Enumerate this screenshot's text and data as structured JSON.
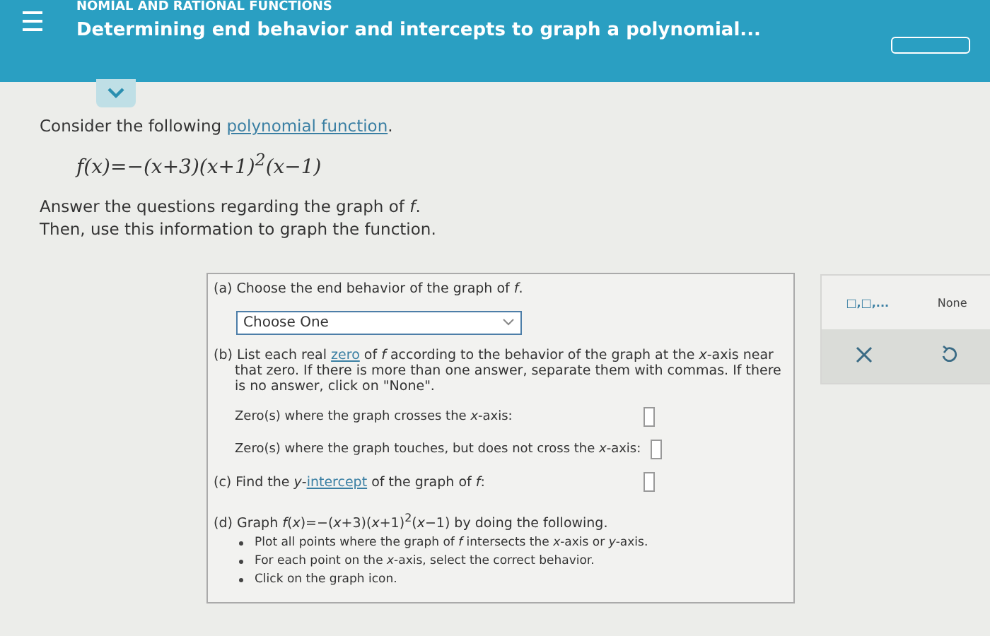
{
  "header": {
    "topic": "NOMIAL AND RATIONAL FUNCTIONS",
    "title": "Determining end behavior and intercepts to graph a polynomial..."
  },
  "intro": {
    "before": "Consider the following ",
    "link": "polynomial function",
    "after": "."
  },
  "formula": "f(x)=−(x+3)(x+1)$^{2}$(x−1)",
  "instructions": [
    "Answer the questions regarding the graph of *f*.",
    "Then, use this information to graph the function."
  ],
  "part_a": {
    "label": "(a) Choose the end behavior of the graph of *f*.",
    "dropdown": "Choose One"
  },
  "part_b": {
    "before": "(b) List each real ",
    "link": "zero",
    "after": " of *f* according to the behavior of the graph at the *x*-axis near that zero. If there is more than one answer, separate them with commas. If there is no answer, click on \"None\".",
    "fields": [
      {
        "label": "Zero(s) where the graph crosses the *x*-axis:"
      },
      {
        "label": "Zero(s) where the graph touches, but does not cross the *x*-axis:"
      }
    ]
  },
  "part_c": {
    "before": "(c) Find the *y*-",
    "link": "intercept",
    "after": " of the graph of *f*:"
  },
  "part_d": {
    "label": "(d) Graph *f*(*x*)=−(*x*+3)(*x*+1)$^{2}$(*x*−1) by doing the following.",
    "bullets": [
      "Plot all points where the graph of *f* intersects the *x*-axis or *y*-axis.",
      "For each point on the *x*-axis, select the correct behavior.",
      "Click on the graph icon."
    ]
  },
  "keypad": {
    "list_key": "□,□,...",
    "none_key": "None"
  }
}
